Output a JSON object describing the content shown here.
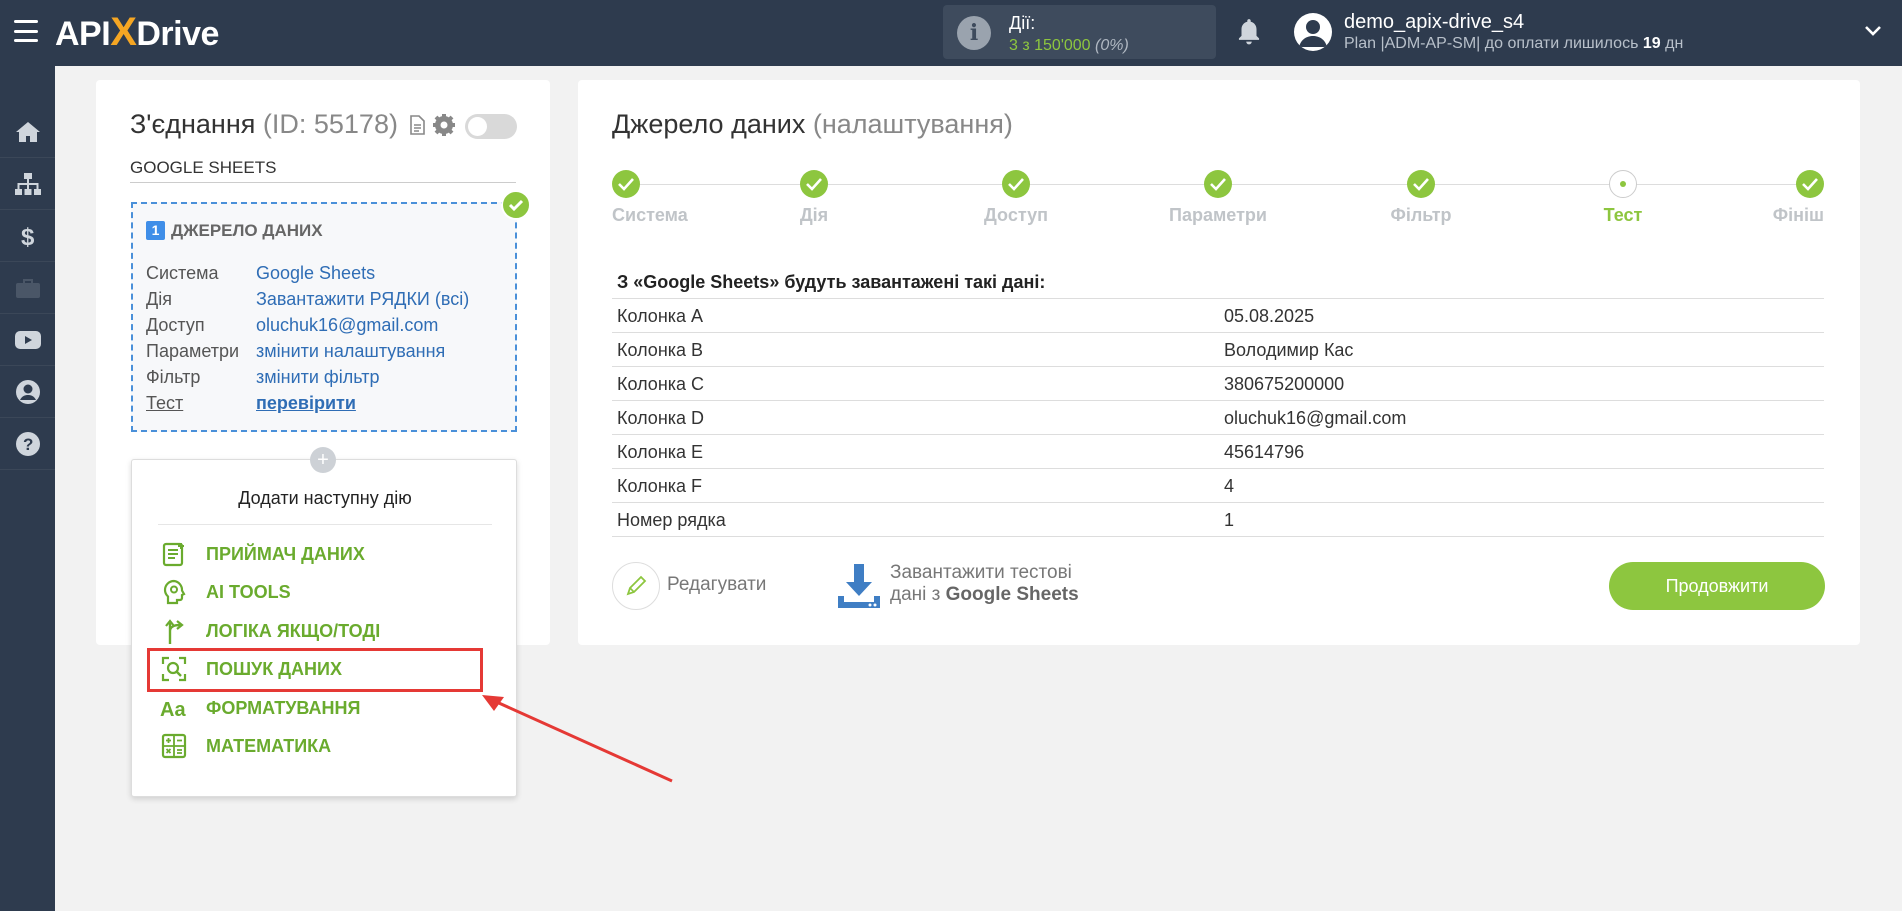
{
  "header": {
    "logo_text_a": "API",
    "logo_text_x": "X",
    "logo_text_b": "Drive",
    "actions_label": "Дії:",
    "actions_value": "3 з 150'000",
    "actions_percent": "(0%)",
    "user_name": "demo_apix-drive_s4",
    "plan_prefix": "Plan |ADM-AP-SM| до оплати лишилось ",
    "plan_days": "19",
    "plan_suffix": " дн"
  },
  "sidebar": {
    "items": [
      "home-icon",
      "sitemap-icon",
      "dollar-icon",
      "briefcase-icon",
      "youtube-icon",
      "user-icon",
      "help-icon"
    ]
  },
  "connection": {
    "title": "З'єднання",
    "id_label": "(ID: 55178)",
    "system_name": "GOOGLE SHEETS",
    "source_num": "1",
    "source_heading": "ДЖЕРЕЛО ДАНИХ",
    "rows": [
      {
        "label": "Система",
        "value": "Google Sheets"
      },
      {
        "label": "Дія",
        "value": "Завантажити РЯДКИ (всі)"
      },
      {
        "label": "Доступ",
        "value": "oluchuk16@gmail.com"
      },
      {
        "label": "Параметри",
        "value": "змінити налаштування"
      },
      {
        "label": "Фільтр",
        "value": "змінити фільтр"
      },
      {
        "label": "Тест",
        "value": "перевірити"
      }
    ]
  },
  "add_action": {
    "plus": "+",
    "title": "Додати наступну дію",
    "items": [
      {
        "label": "ПРИЙМАЧ ДАНИХ",
        "icon": "receiver-icon"
      },
      {
        "label": "AI TOOLS",
        "icon": "ai-icon"
      },
      {
        "label": "ЛОГІКА ЯКЩО/ТОДІ",
        "icon": "logic-icon"
      },
      {
        "label": "ПОШУК ДАНИХ",
        "icon": "search-data-icon"
      },
      {
        "label": "ФОРМАТУВАННЯ",
        "icon": "format-icon"
      },
      {
        "label": "МАТЕМАТИКА",
        "icon": "math-icon"
      }
    ]
  },
  "source": {
    "title": "Джерело даних",
    "subtitle": "(налаштування)",
    "steps": [
      {
        "label": "Система",
        "state": "done"
      },
      {
        "label": "Дія",
        "state": "done"
      },
      {
        "label": "Доступ",
        "state": "done"
      },
      {
        "label": "Параметри",
        "state": "done"
      },
      {
        "label": "Фільтр",
        "state": "done"
      },
      {
        "label": "Тест",
        "state": "current"
      },
      {
        "label": "Фініш",
        "state": "done"
      }
    ],
    "table_heading": "З «Google Sheets» будуть завантажені такі дані:",
    "table": [
      {
        "key": "Колонка A",
        "value": "05.08.2025"
      },
      {
        "key": "Колонка B",
        "value": "Володимир Кас"
      },
      {
        "key": "Колонка C",
        "value": "380675200000"
      },
      {
        "key": "Колонка D",
        "value": "oluchuk16@gmail.com"
      },
      {
        "key": "Колонка E",
        "value": "45614796"
      },
      {
        "key": "Колонка F",
        "value": "4"
      },
      {
        "key": "Номер рядка",
        "value": "1"
      }
    ],
    "edit_label": "Редагувати",
    "download_line1": "Завантажити тестові",
    "download_line2_prefix": "дані з ",
    "download_line2_bold": "Google Sheets",
    "continue_label": "Продовжити"
  },
  "colors": {
    "accent_green": "#8dc63f",
    "nav_bg": "#2e3b4e",
    "link_blue": "#2f6db5",
    "highlight_red": "#e53935"
  }
}
